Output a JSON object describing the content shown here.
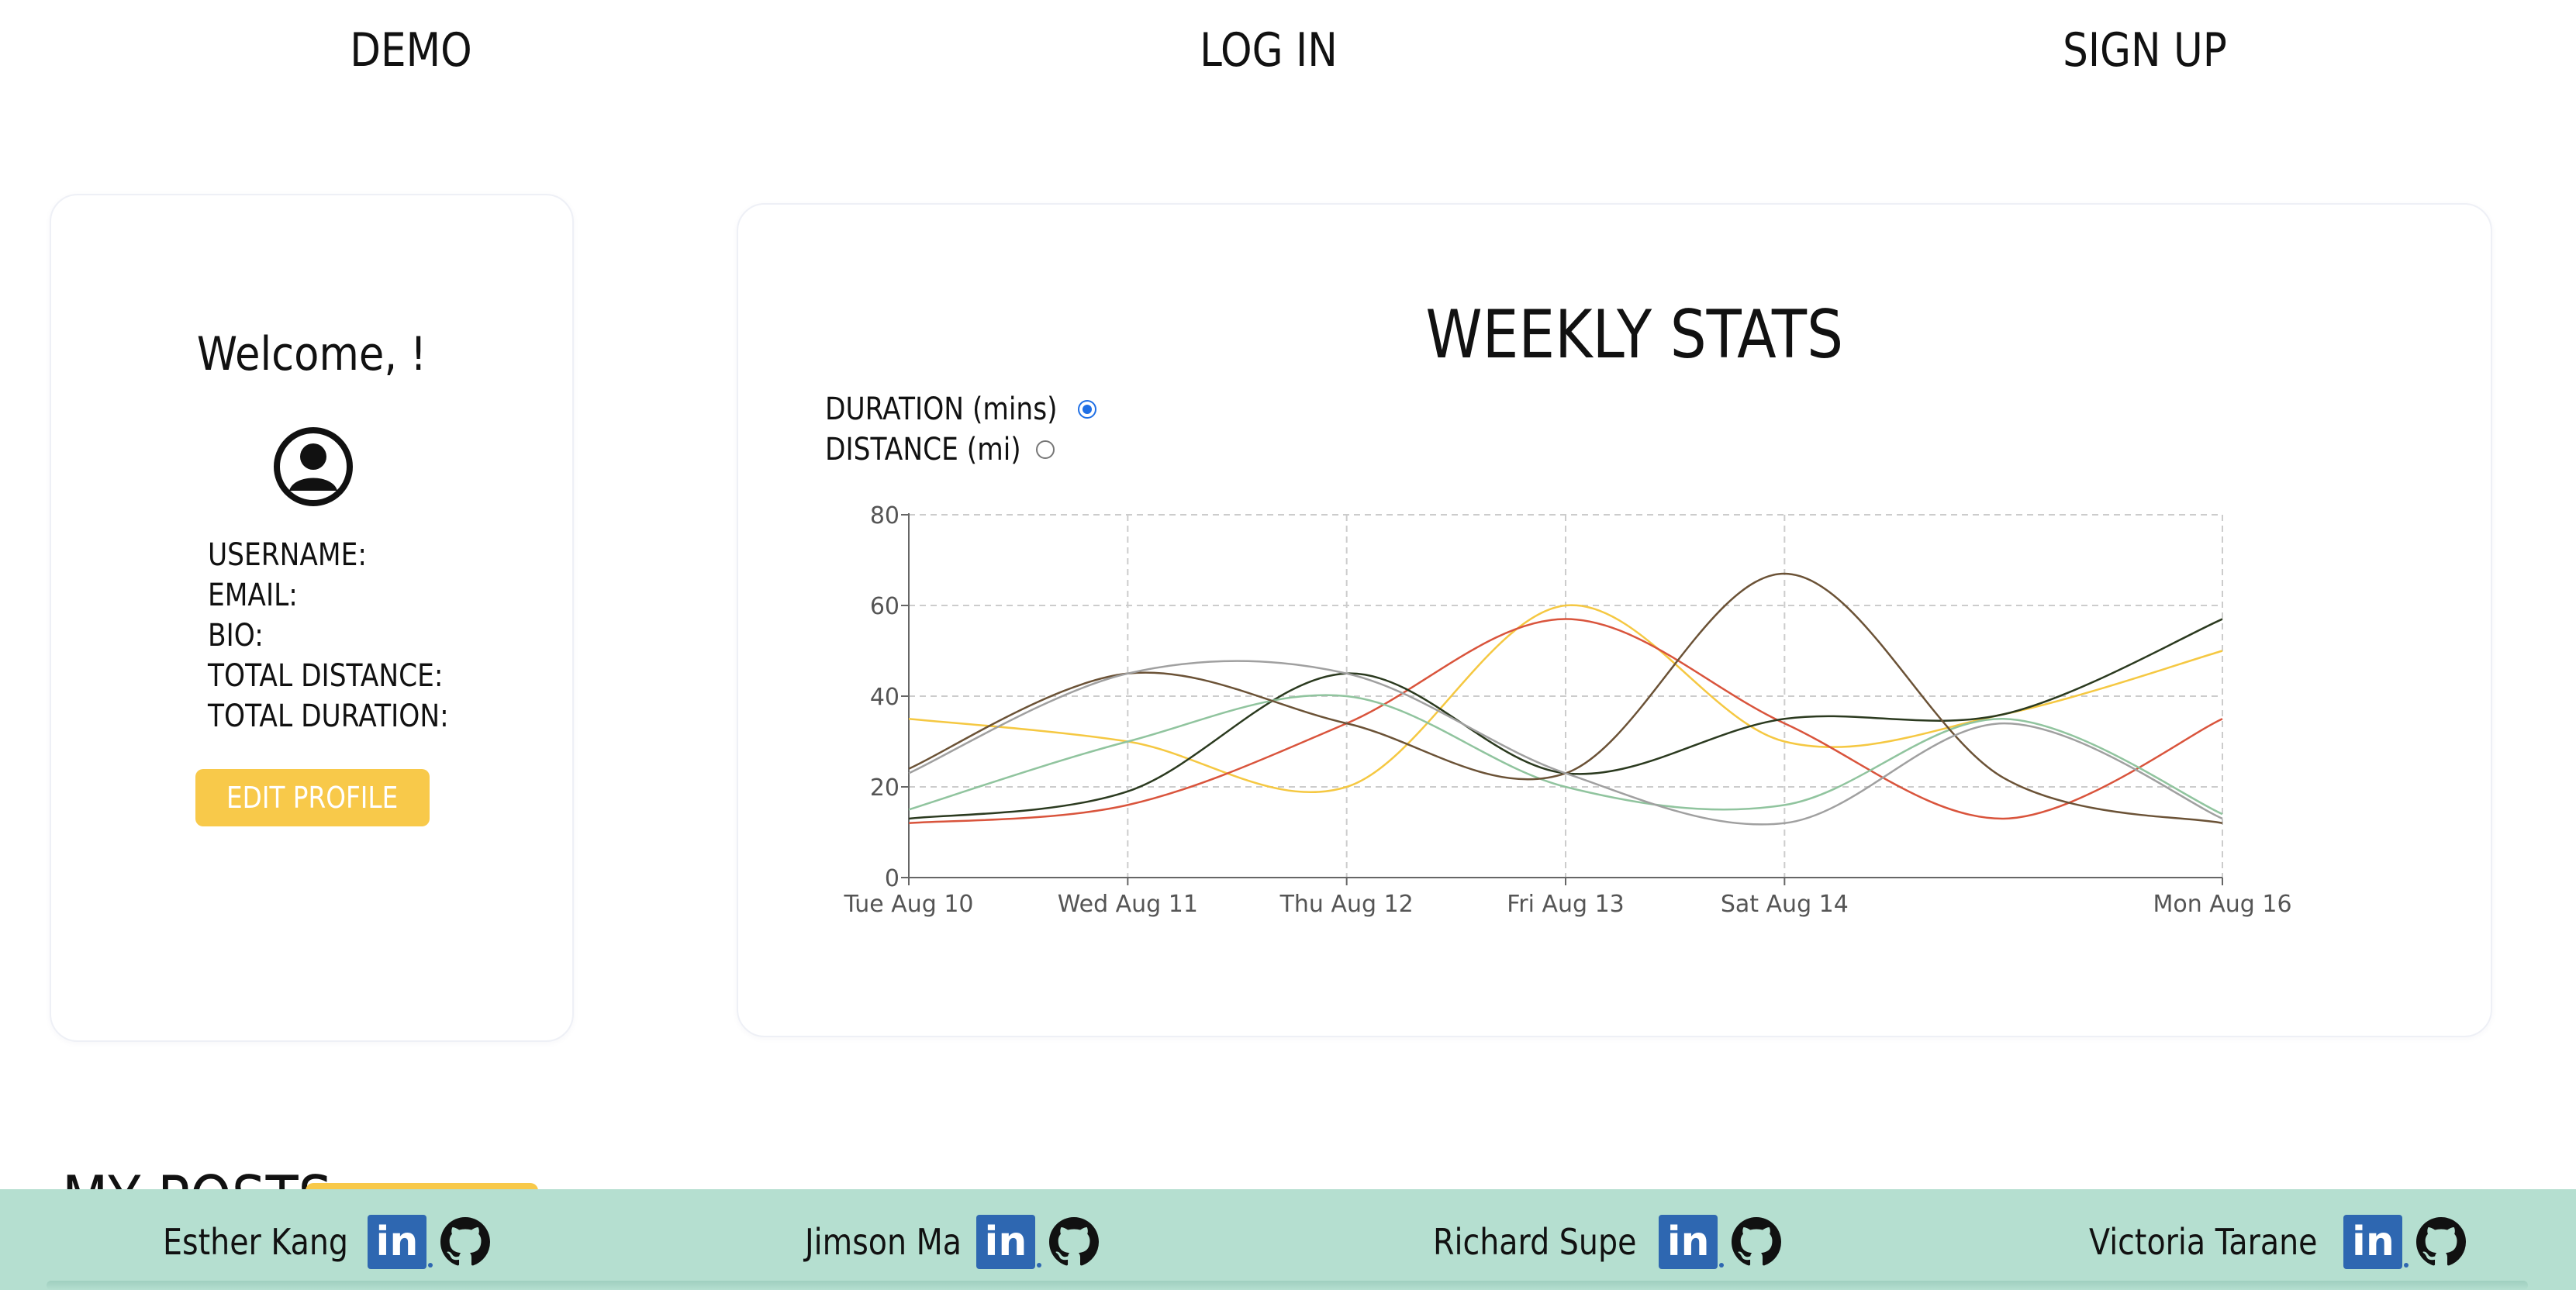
{
  "nav": {
    "demo": "DEMO",
    "login": "LOG IN",
    "signup": "SIGN UP"
  },
  "profile": {
    "welcome": "Welcome, !",
    "fields": [
      "USERNAME:",
      "EMAIL:",
      "BIO:",
      "TOTAL DISTANCE:",
      "TOTAL DURATION:"
    ],
    "edit_button": "EDIT PROFILE",
    "avatar_icon": "user-circle-icon"
  },
  "stats": {
    "title": "WEEKLY STATS",
    "options": [
      {
        "label": "DURATION (mins)",
        "checked": true
      },
      {
        "label": "DISTANCE (mi)",
        "checked": false
      }
    ]
  },
  "chart_data": {
    "type": "line",
    "x": [
      "Tue Aug 10",
      "Wed Aug 11",
      "Thu Aug 12",
      "Fri Aug 13",
      "Sat Aug 14",
      "Mon Aug 16"
    ],
    "ylim": [
      0,
      80
    ],
    "yticks": [
      0,
      20,
      40,
      60,
      80
    ],
    "grid": true,
    "series": [
      {
        "color": "#f5c842",
        "points": [
          [
            0,
            35
          ],
          [
            1,
            30
          ],
          [
            2,
            20
          ],
          [
            3,
            60
          ],
          [
            4,
            30
          ],
          [
            5,
            36
          ],
          [
            6,
            50
          ]
        ]
      },
      {
        "color": "#d9543c",
        "points": [
          [
            0,
            12
          ],
          [
            1,
            16
          ],
          [
            2,
            34
          ],
          [
            3,
            57
          ],
          [
            4,
            34
          ],
          [
            5,
            13
          ],
          [
            6,
            35
          ]
        ]
      },
      {
        "color": "#2b3a1f",
        "points": [
          [
            0,
            13
          ],
          [
            1,
            19
          ],
          [
            2,
            45
          ],
          [
            3,
            23
          ],
          [
            4,
            35
          ],
          [
            5,
            36
          ],
          [
            6,
            57
          ]
        ]
      },
      {
        "color": "#90c49e",
        "points": [
          [
            0,
            15
          ],
          [
            1,
            30
          ],
          [
            2,
            40
          ],
          [
            3,
            20
          ],
          [
            4,
            16
          ],
          [
            5,
            35
          ],
          [
            6,
            14
          ]
        ]
      },
      {
        "color": "#6b5236",
        "points": [
          [
            0,
            24
          ],
          [
            1,
            45
          ],
          [
            2,
            34
          ],
          [
            3,
            23
          ],
          [
            4,
            67
          ],
          [
            5,
            22
          ],
          [
            6,
            12
          ]
        ]
      },
      {
        "color": "#a0a0a0",
        "points": [
          [
            0,
            23
          ],
          [
            1,
            45
          ],
          [
            2,
            45
          ],
          [
            3,
            23
          ],
          [
            4,
            12
          ],
          [
            5,
            34
          ],
          [
            6,
            13
          ]
        ]
      }
    ]
  },
  "posts": {
    "title": "MY POSTS"
  },
  "footer": {
    "members": [
      {
        "name": "Esther Kang"
      },
      {
        "name": "Jimson Ma"
      },
      {
        "name": "Richard Supe"
      },
      {
        "name": "Victoria Tarane"
      }
    ]
  }
}
